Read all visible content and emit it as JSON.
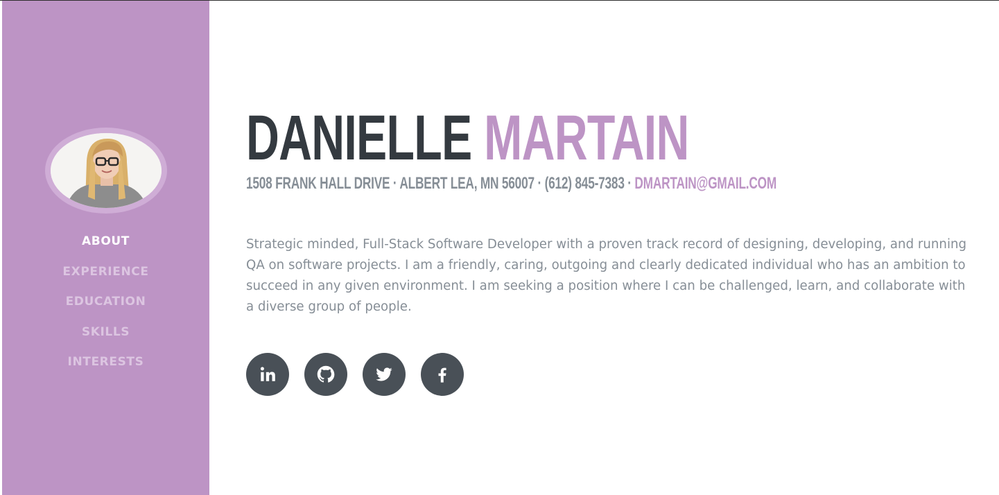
{
  "profile": {
    "first_name": "DANIELLE",
    "last_name": "MARTAIN",
    "contact_text": "1508 FRANK HALL DRIVE · ALBERT LEA, MN 56007 · (612) 845-7383 · ",
    "email": "DMARTAIN@GMAIL.COM",
    "bio": "Strategic minded, Full-Stack Software Developer with a proven track record of designing, developing, and running QA on software projects. I am a friendly, caring, outgoing and clearly dedicated individual who has an ambition to succeed in any given environment. I am seeking a position where I can be challenged, learn, and collaborate with a diverse group of people."
  },
  "nav": {
    "items": [
      {
        "label": "ABOUT",
        "active": true
      },
      {
        "label": "EXPERIENCE",
        "active": false
      },
      {
        "label": "EDUCATION",
        "active": false
      },
      {
        "label": "SKILLS",
        "active": false
      },
      {
        "label": "INTERESTS",
        "active": false
      }
    ]
  },
  "social": {
    "icons": [
      "linkedin-icon",
      "github-icon",
      "twitter-icon",
      "facebook-icon"
    ]
  },
  "colors": {
    "accent": "#bd94c5",
    "dark": "#343a40",
    "muted": "#868e96",
    "social_bg": "#495057"
  }
}
